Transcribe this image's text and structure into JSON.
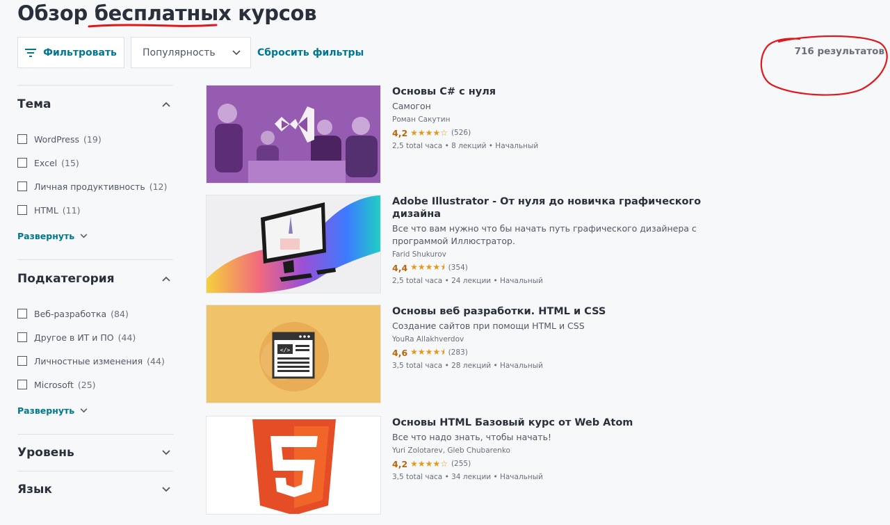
{
  "header": {
    "title": "Обзор бесплатных курсов"
  },
  "toolbar": {
    "filter_label": "Фильтровать",
    "filter_icon": "filter-lines-icon",
    "sort_value": "Популярность",
    "reset_label": "Сбросить фильтры",
    "results": "716 результатов"
  },
  "sidebar": {
    "sections": [
      {
        "title": "Тема",
        "items": [
          {
            "label": "WordPress",
            "count": "(19)"
          },
          {
            "label": "Excel",
            "count": "(15)"
          },
          {
            "label": "Личная продуктивность",
            "count": "(12)"
          },
          {
            "label": "HTML",
            "count": "(11)"
          }
        ],
        "expand": "Развернуть"
      },
      {
        "title": "Подкатегория",
        "items": [
          {
            "label": "Веб-разработка",
            "count": "(84)"
          },
          {
            "label": "Другое в ИТ и ПО",
            "count": "(44)"
          },
          {
            "label": "Личностные изменения",
            "count": "(44)"
          },
          {
            "label": "Microsoft",
            "count": "(25)"
          }
        ],
        "expand": "Развернуть"
      },
      {
        "title": "Уровень"
      },
      {
        "title": "Язык"
      }
    ]
  },
  "courses": [
    {
      "title": "Основы C# с нуля",
      "description": "Самогон",
      "author": "Роман Сакутин",
      "rating": "4,2",
      "stars": "★★★★☆",
      "reviews": "(526)",
      "meta": "2,5 total часа • 8 лекций • Начальный"
    },
    {
      "title": "Adobe Illustrator - От нуля до новичка графического дизайна",
      "description": "Все что вам нужно что бы начать путь графического дизайнера с программой Иллюстратор.",
      "author": "Farid Shukurov",
      "rating": "4,4",
      "stars": "★★★★⯨",
      "reviews": "(354)",
      "meta": "2,5 total часа • 24 лекции • Начальный"
    },
    {
      "title": "Основы веб разработки. HTML и CSS",
      "description": "Создание сайтов при помощи HTML и CSS",
      "author": "YouRa Allakhverdov",
      "rating": "4,6",
      "stars": "★★★★⯨",
      "reviews": "(283)",
      "meta": "3,5 total часа • 28 лекций • Начальный"
    },
    {
      "title": "Основы HTML Базовый курс от Web Atom",
      "description": "Все что надо знать, чтобы начать!",
      "author": "Yuri Zolotarev, Gleb Chubarenko",
      "rating": "4,2",
      "stars": "★★★★☆",
      "reviews": "(255)",
      "meta": "3,5 total часа • 34 лекции • Начальный"
    }
  ],
  "colors": {
    "accent": "#007791",
    "rating": "#b4690e",
    "star": "#e59819",
    "annotation": "#e0181c"
  }
}
